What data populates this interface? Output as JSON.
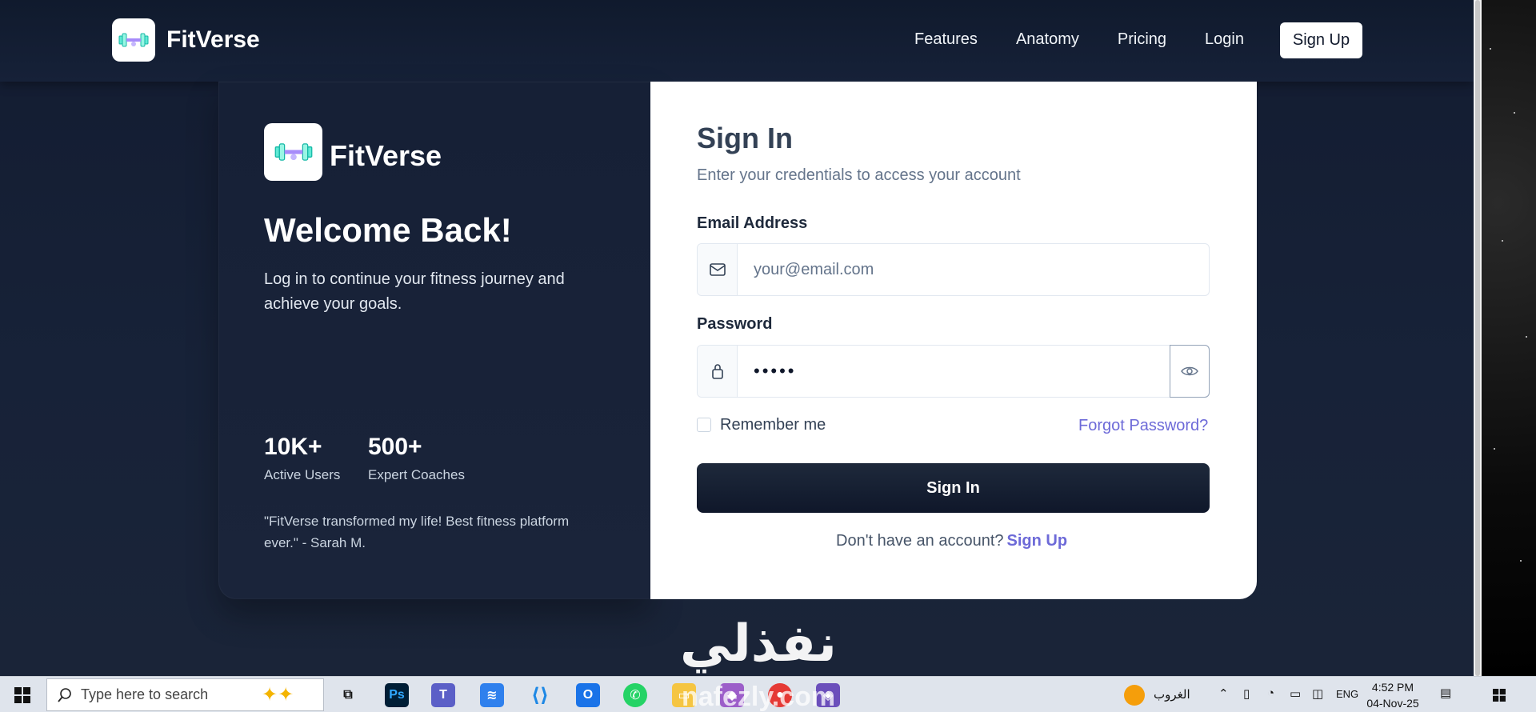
{
  "nav": {
    "brand": "FitVerse",
    "links": [
      "Features",
      "Anatomy",
      "Pricing",
      "Login"
    ],
    "signup": "Sign Up"
  },
  "left_panel": {
    "brand": "FitVerse",
    "heading": "Welcome Back!",
    "subtext": "Log in to continue your fitness journey and achieve your goals.",
    "stats": [
      {
        "value": "10K+",
        "label": "Active Users"
      },
      {
        "value": "500+",
        "label": "Expert Coaches"
      }
    ],
    "quote": "\"FitVerse transformed my life! Best fitness platform ever.\" - Sarah M."
  },
  "form": {
    "title": "Sign In",
    "subtitle": "Enter your credentials to access your account",
    "email_label": "Email Address",
    "email_placeholder": "your@email.com",
    "password_label": "Password",
    "password_value": "•••••",
    "remember": "Remember me",
    "forgot": "Forgot Password?",
    "submit": "Sign In",
    "no_account": "Don't have an account?",
    "signup_link": "Sign Up"
  },
  "watermark": {
    "arabic": "نفذلي",
    "latin": "nafezly.com"
  },
  "taskbar": {
    "search_placeholder": "Type here to search",
    "weather": "الغروب",
    "language": "ENG",
    "time": "4:52 PM",
    "date": "04-Nov-25"
  },
  "colors": {
    "accent": "#6d6ad8",
    "dark": "#0f172a",
    "nav_bg": "#101a2d"
  }
}
